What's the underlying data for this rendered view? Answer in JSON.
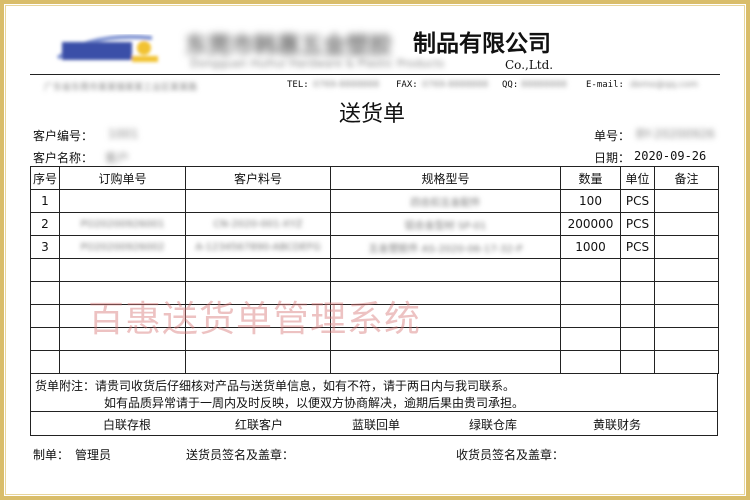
{
  "company": {
    "name_blurred": "东莞市韩惠五金塑胶",
    "name_suffix": "制品有限公司",
    "name_en": "Co.,Ltd.",
    "address_blurred": "Dongguan Huihui Hardware & Plastic Products"
  },
  "contact": {
    "tel_label": "TEL:",
    "fax_label": "FAX:",
    "qq_label": "QQ:",
    "email_label": "E-mail:",
    "address_blurred": "广东省东莞市某某镇某某工业区某某路",
    "tel_blurred": "0769-8888888",
    "fax_blurred": "0769-8888888",
    "qq_blurred": "88888888",
    "email_blurred": "demo@qq.com"
  },
  "doc": {
    "title": "送货单",
    "customer_no_label": "客户编号：",
    "customer_no_blurred": "1001",
    "customer_name_label": "客户名称：",
    "customer_name_blurred": "客户",
    "doc_no_label": "单号：",
    "doc_no_blurred": "BY-20200926",
    "date_label": "日期：",
    "date": "2020-09-26"
  },
  "table": {
    "headers": [
      "序号",
      "订购单号",
      "客户料号",
      "规格型号",
      "数量",
      "单位",
      "备注"
    ],
    "rows": [
      {
        "no": "1",
        "po": "",
        "part": "",
        "spec": "四合扣五金配件",
        "qty": "100",
        "unit": "PCS",
        "remark": ""
      },
      {
        "no": "2",
        "po": "PO20200926001",
        "part": "CN-2020-001-XYZ",
        "spec": "铝合金型材 SP-01",
        "qty": "200000",
        "unit": "PCS",
        "remark": ""
      },
      {
        "no": "3",
        "po": "PO20200926002",
        "part": "A-1234567890-ABCDEFG",
        "spec": "五金塑胶件 AS-2020-06-17-32-P",
        "qty": "1000",
        "unit": "PCS",
        "remark": ""
      }
    ],
    "empty_rows": 5
  },
  "watermark": "百惠送货单管理系统",
  "notes": {
    "label": "货单附注：",
    "line1": "请贵司收货后仔细核对产品与送货单信息，如有不符，请于两日内与我司联系。",
    "line2": "如有品质异常请于一周内及时反映，以便双方协商解决，逾期后果由贵司承担。"
  },
  "copies": [
    "白联存根",
    "红联客户",
    "蓝联回单",
    "绿联仓库",
    "黄联财务"
  ],
  "footer": {
    "maker_label": "制单：",
    "maker": "管理员",
    "sender_label": "送货员签名及盖章：",
    "receiver_label": "收货员签名及盖章："
  },
  "colors": {
    "frame": "#d9bd6a",
    "watermark": "#d67878",
    "logo_blue": "#3a4fa8",
    "logo_yellow": "#f2c230"
  }
}
